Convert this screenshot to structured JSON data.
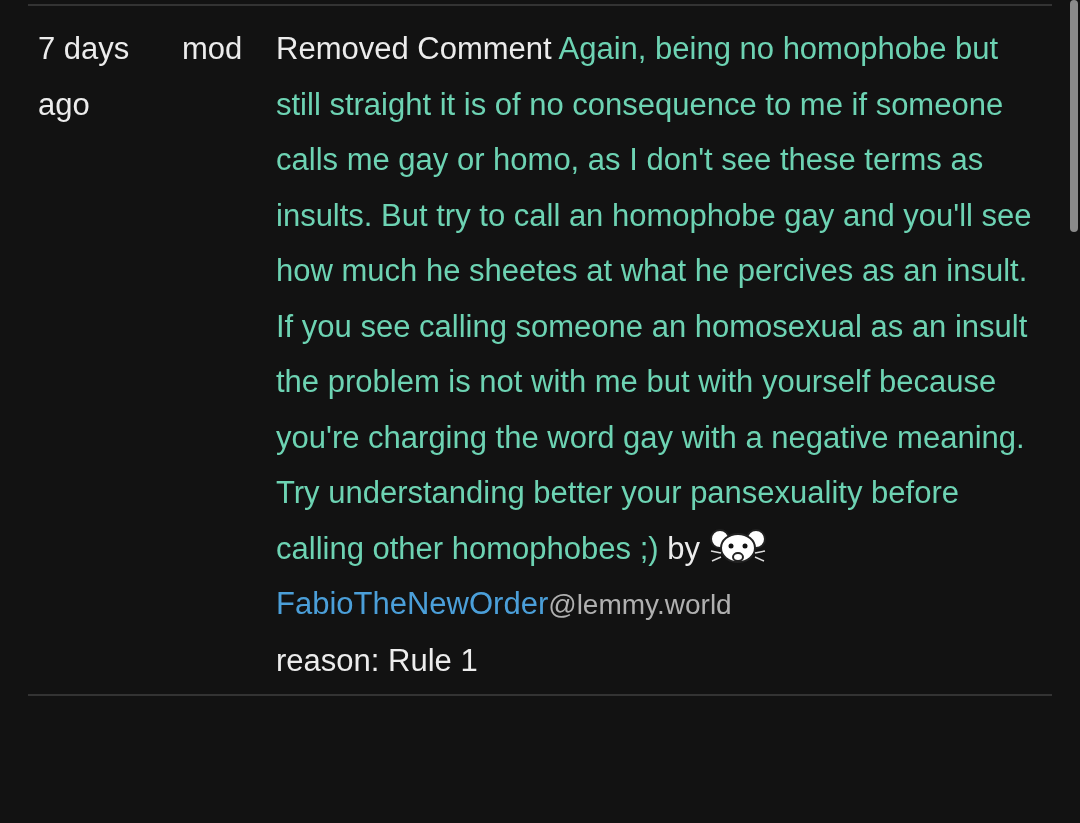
{
  "row": {
    "time": "7 days ago",
    "role": "mod",
    "action": "Removed Comment",
    "comment": "Again, being no homophobe but still straight it is of no consequence to me if someone calls me gay or homo, as I don't see these terms as insults. But try to call an homophobe gay and you'll see how much he sheetes at what he percives as an insult. If you see calling someone an homosexual as an insult the problem is not with me but with yourself because you're charging the word gay with a negative meaning. Try understanding better your pansexuality before calling other homophobes ;)",
    "by": "by",
    "user": "FabioTheNewOrder",
    "instance": "@lemmy.world",
    "reason": "reason: Rule 1"
  }
}
